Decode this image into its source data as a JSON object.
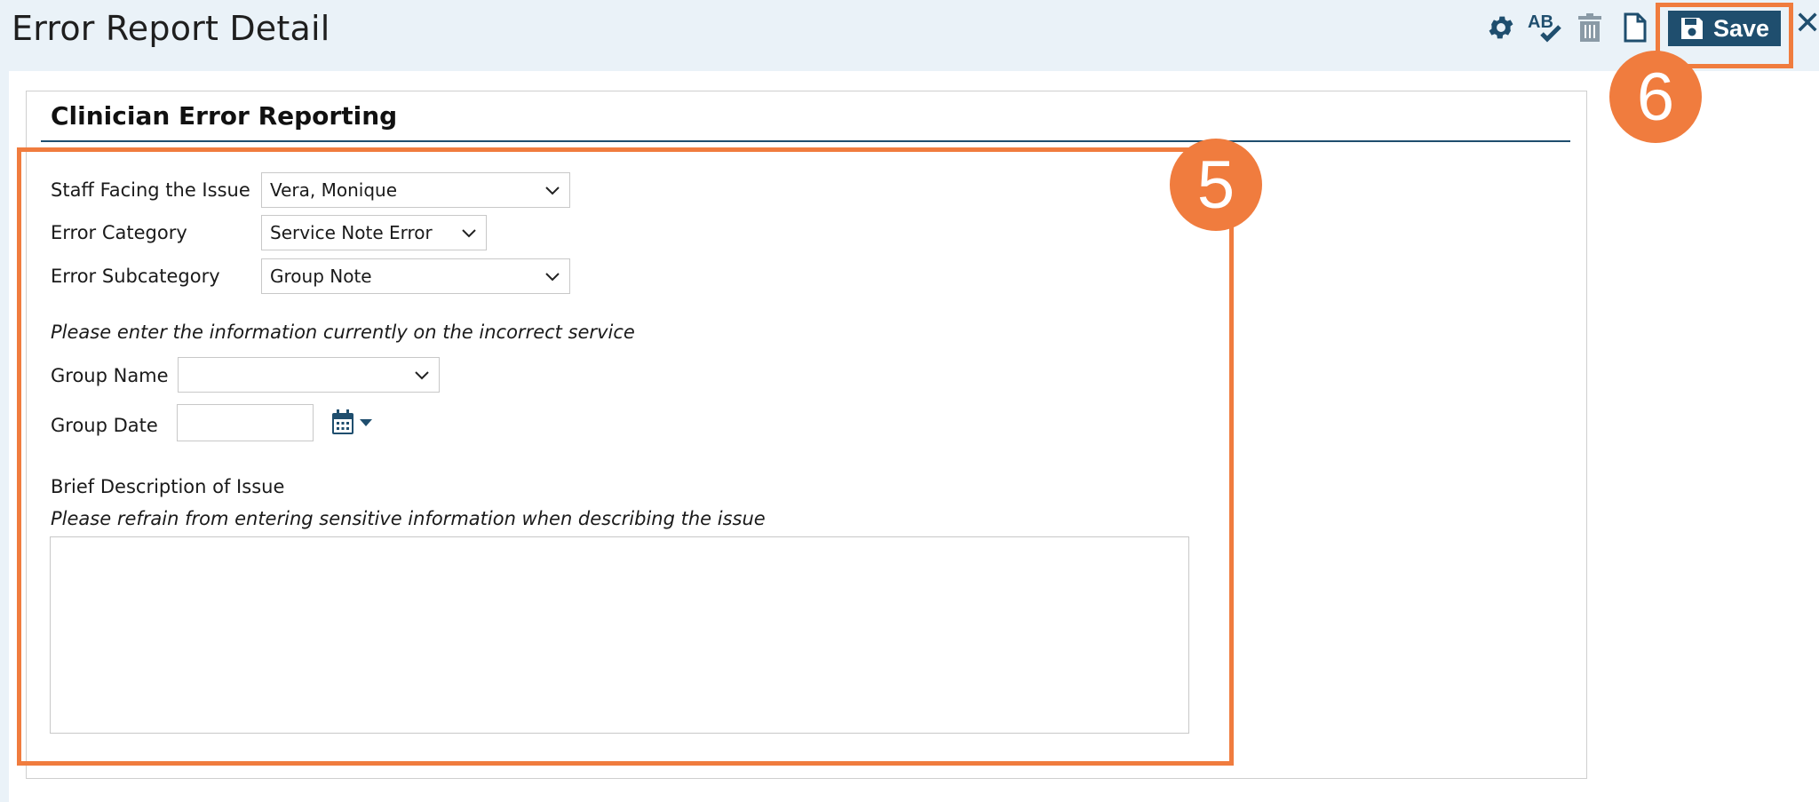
{
  "header": {
    "title": "Error Report Detail",
    "save_label": "Save",
    "close_symbol": "✕",
    "icons": [
      "gear-icon",
      "spellcheck-icon",
      "trash-icon",
      "document-icon",
      "floppy-disk-icon",
      "close-icon"
    ]
  },
  "panel": {
    "title": "Clinician Error Reporting"
  },
  "form": {
    "staff_label": "Staff Facing the Issue",
    "staff_value": "Vera, Monique",
    "category_label": "Error Category",
    "category_value": "Service Note Error",
    "subcategory_label": "Error Subcategory",
    "subcategory_value": "Group Note",
    "incorrect_service_note": "Please enter the information currently on the incorrect service",
    "group_name_label": "Group Name",
    "group_name_value": "",
    "group_date_label": "Group Date",
    "group_date_value": "",
    "description_label": "Brief Description of Issue",
    "description_note": "Please refrain from entering sensitive information when describing the issue",
    "description_value": ""
  },
  "annotations": {
    "step5": "5",
    "step6": "6",
    "color": "#f07c3e"
  },
  "colors": {
    "accent": "#1f4e6e",
    "header_bg": "#eaf2f8"
  }
}
